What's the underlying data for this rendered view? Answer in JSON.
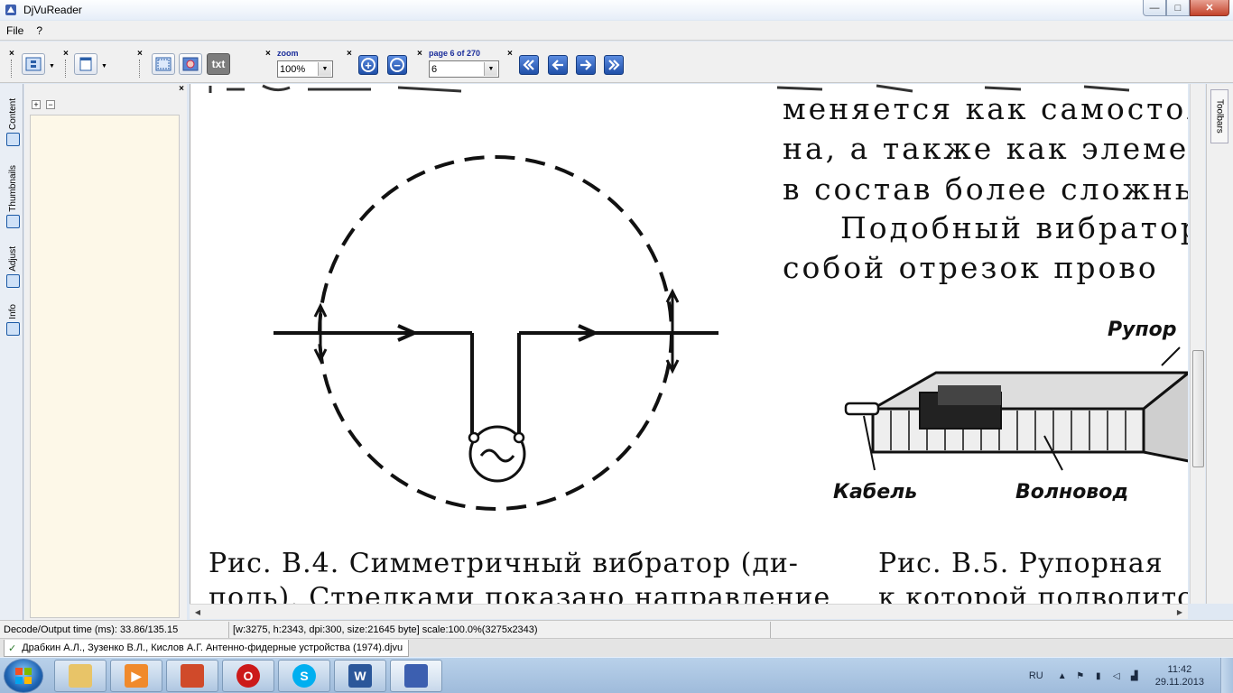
{
  "window": {
    "title": "DjVuReader",
    "controls": {
      "minimize": "—",
      "maximize": "□",
      "close": "✕"
    }
  },
  "menu": {
    "items": [
      "File",
      "?"
    ]
  },
  "toolbar": {
    "zoom_label": "zoom",
    "zoom_value": "100%",
    "page_label": "page 6 of 270",
    "page_value": "6",
    "text_button": "txt"
  },
  "left_panel": {
    "tabs": [
      "Content",
      "Thumbnails",
      "Adjust",
      "Info"
    ],
    "tree_expand": "+",
    "tree_collapse": "−"
  },
  "right_strip": {
    "tab_label": "Toolbars"
  },
  "document": {
    "right_lines": [
      "меняется как самостоя",
      "на, а также как элеме",
      "в состав более сложных",
      "Подобный вибратор",
      "собой отрезок прово"
    ],
    "labels": {
      "horn": "Рупор",
      "cable": "Кабель",
      "waveguide": "Волновод"
    },
    "caption_left": [
      "Рис. В.4. Симметричный вибратор (ди-",
      "поль). Стрелками показано направление"
    ],
    "caption_right": [
      "Рис. В.5. Рупорная",
      "к которой подводитс"
    ]
  },
  "status": {
    "decode_time": "Decode/Output time (ms): 33.86/135.15",
    "image_info": "[w:3275, h:2343, dpi:300, size:21645 byte] scale:100.0%(3275x2343)"
  },
  "doc_tab": {
    "label": "Драбкин А.Л., Зузенко В.Л., Кислов А.Г. Антенно-фидерные устройства (1974).djvu"
  },
  "taskbar": {
    "language": "RU",
    "time": "11:42",
    "date": "29.11.2013"
  }
}
